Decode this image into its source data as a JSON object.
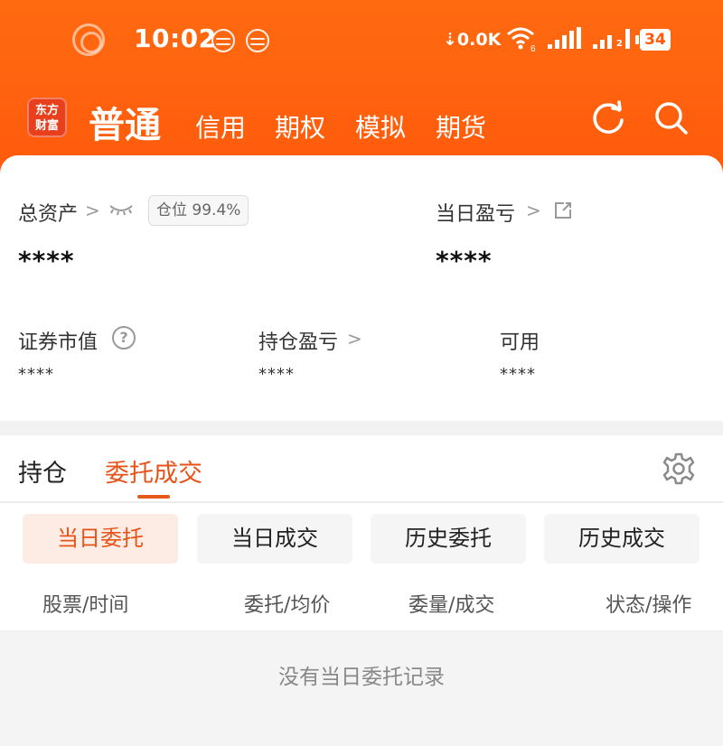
{
  "status_bar": {
    "time": "10:02",
    "network_speed": "0.0K",
    "wifi_badge": "6",
    "sim2_badge": "2",
    "battery": "34"
  },
  "app_header": {
    "logo_line1": "东方",
    "logo_line2": "财富",
    "account_tabs": [
      {
        "label": "普通",
        "active": true
      },
      {
        "label": "信用",
        "active": false
      },
      {
        "label": "期权",
        "active": false
      },
      {
        "label": "模拟",
        "active": false
      },
      {
        "label": "期货",
        "active": false
      }
    ],
    "icons": [
      "refresh-icon",
      "search-icon"
    ],
    "brand_color": "#ff5f0f"
  },
  "summary": {
    "total_assets_label": "总资产",
    "position_ratio_label": "仓位 99.4%",
    "total_assets_value": "****",
    "daily_pnl_label": "当日盈亏",
    "daily_pnl_value": "****",
    "market_value_label": "证券市值",
    "market_value_value": "****",
    "holding_pnl_label": "持仓盈亏",
    "holding_pnl_value": "****",
    "available_label": "可用",
    "available_value": "****",
    "chevron": ">"
  },
  "main_tabs": [
    {
      "label": "持仓",
      "active": false
    },
    {
      "label": "委托成交",
      "active": true
    }
  ],
  "sub_tabs": [
    {
      "label": "当日委托",
      "active": true
    },
    {
      "label": "当日成交",
      "active": false
    },
    {
      "label": "历史委托",
      "active": false
    },
    {
      "label": "历史成交",
      "active": false
    }
  ],
  "columns": [
    "股票/时间",
    "委托/均价",
    "委量/成交",
    "状态/操作"
  ],
  "empty_message": "没有当日委托记录",
  "accent_color": "#e6531a"
}
